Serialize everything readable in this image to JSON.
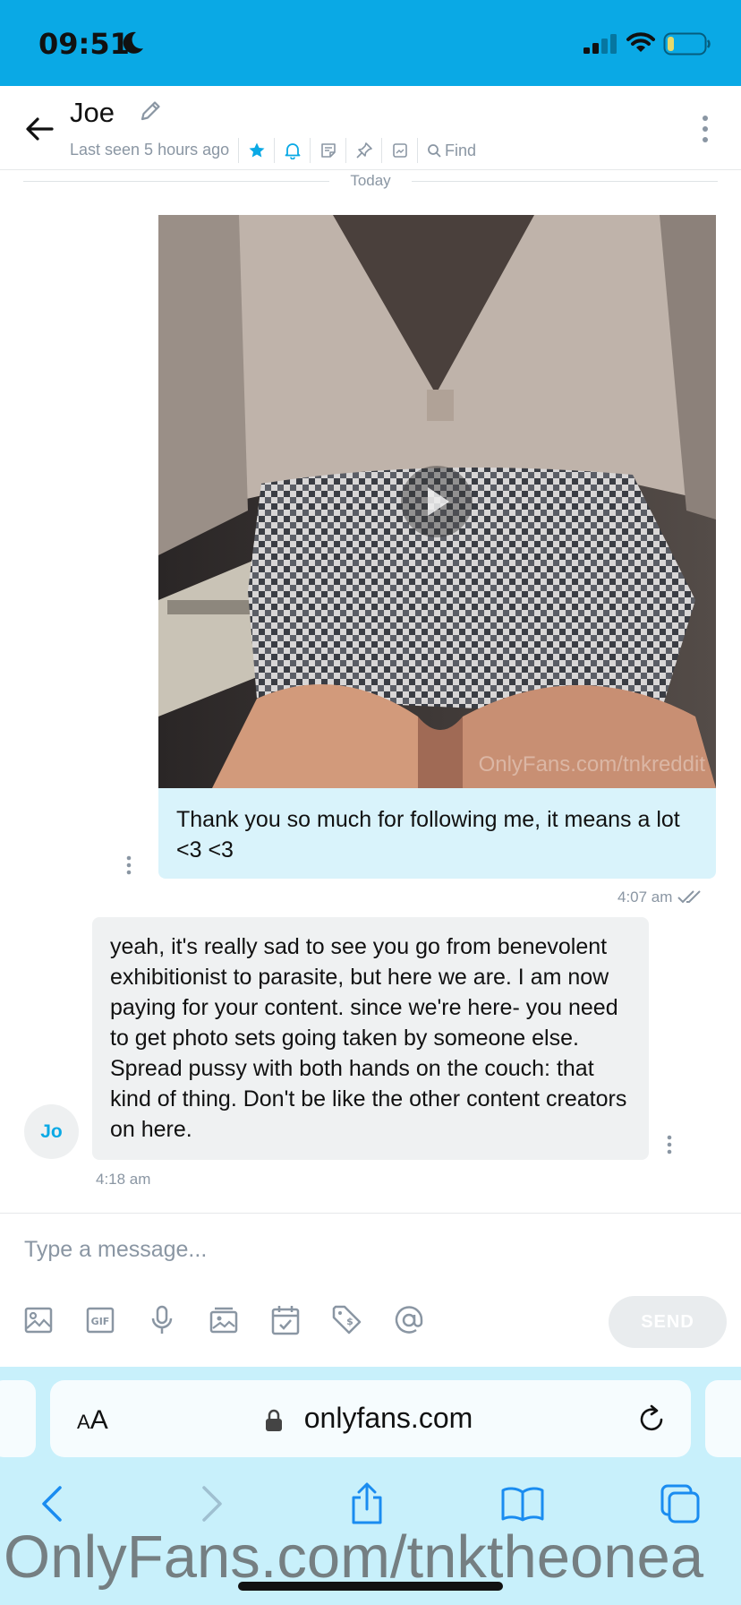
{
  "status_bar": {
    "time": "09:51"
  },
  "header": {
    "contact_name": "Joe",
    "last_seen": "Last seen 5 hours ago",
    "find_label": "Find"
  },
  "date_divider": "Today",
  "messages": [
    {
      "direction": "outgoing",
      "media": {
        "type": "video",
        "watermark": "OnlyFans.com/tnkreddit"
      },
      "text": "Thank you so much for following me, it means a lot <3 <3",
      "time": "4:07 am",
      "read": true
    },
    {
      "direction": "incoming",
      "avatar_initials": "Jo",
      "text": "yeah, it's really sad to see you go from benevolent exhibitionist to parasite, but here we are. I am now paying for your content. since we're here- you need to get photo sets going taken by someone else. Spread pussy with both hands on the couch: that kind of thing. Don't be like the other content creators on here.",
      "time": "4:18 am"
    }
  ],
  "composer": {
    "placeholder": "Type a message...",
    "value": "",
    "send_label": "SEND",
    "tools": [
      "image-icon",
      "gif-icon",
      "microphone-icon",
      "vault-icon",
      "calendar-icon",
      "price-tag-icon",
      "mention-icon"
    ]
  },
  "browser": {
    "text_size_label_small": "A",
    "text_size_label_large": "A",
    "url_host": "onlyfans.com"
  },
  "overlay_watermark": "OnlyFans.com/tnktheonea",
  "colors": {
    "accent": "#0aa9e5",
    "outgoing_bubble": "#d9f3fb",
    "incoming_bubble": "#eff1f2",
    "muted_text": "#8a96a3",
    "browser_chrome": "#c8f0fb"
  }
}
